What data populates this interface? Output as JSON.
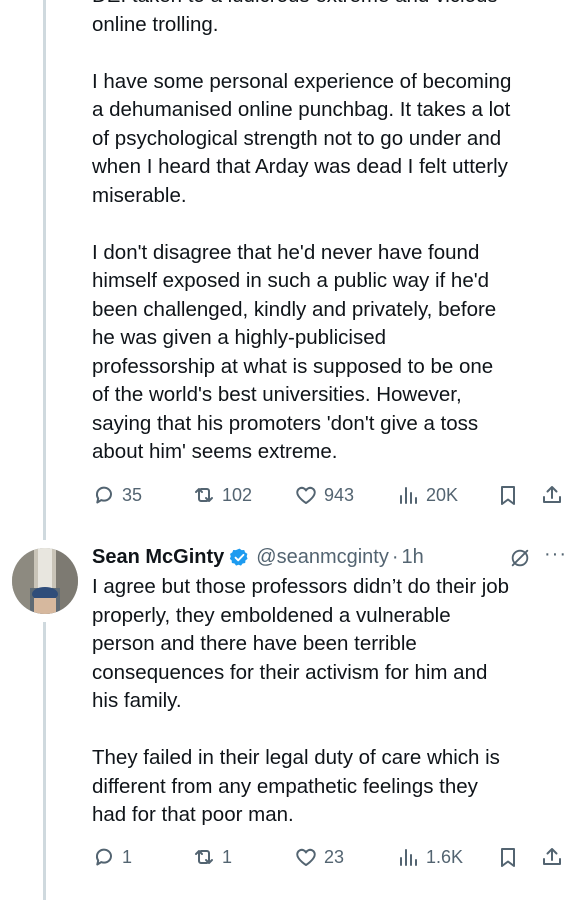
{
  "tweet1": {
    "paragraphs": [
      "DEI taken to a ludicrous extreme and vicious\nonline trolling.",
      "I have some personal experience of becoming\na dehumanised online punchbag. It takes a lot\nof psychological strength not to go under and\nwhen I heard that Arday was dead I felt utterly\nmiserable.",
      "I don't disagree that he'd never have found\nhimself exposed in such a public way if he'd\nbeen challenged, kindly and privately, before\nhe was given a highly-publicised\nprofessorship at what is supposed to be one\nof the world's best universities. However,\nsaying that his promoters 'don't give a toss\nabout him' seems extreme."
    ],
    "actions": {
      "replies": "35",
      "reposts": "102",
      "likes": "943",
      "views": "20K"
    }
  },
  "tweet2": {
    "display_name": "Sean McGinty",
    "handle": "@seanmcginty",
    "separator": "·",
    "time": "1h",
    "more": "···",
    "paragraphs": [
      "I agree but those professors didn’t do their job\nproperly, they emboldened a vulnerable\nperson and there have been terrible\nconsequences for their activism for him and\nhis family.",
      "They failed in their legal duty of care which is\ndifferent from any empathetic feelings they\nhad for that poor man."
    ],
    "actions": {
      "replies": "1",
      "reposts": "1",
      "likes": "23",
      "views": "1.6K"
    }
  },
  "colors": {
    "text": "#0f1419",
    "secondary": "#536471",
    "verified": "#1d9bf0",
    "thread_line": "#cfd9de"
  },
  "icons": [
    "reply-icon",
    "repost-icon",
    "like-icon",
    "views-icon",
    "bookmark-icon",
    "share-icon",
    "verified-badge-icon",
    "grok-icon",
    "more-icon"
  ]
}
